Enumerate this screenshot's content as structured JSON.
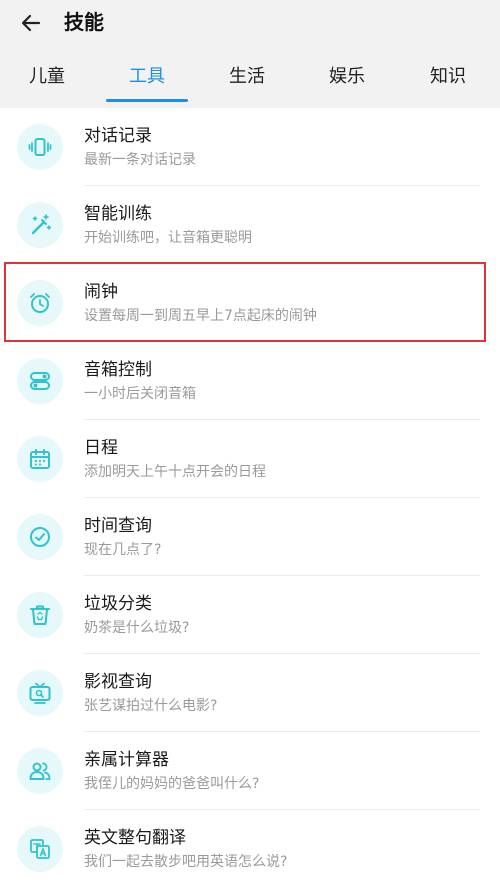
{
  "header": {
    "title": "技能",
    "tabs": [
      {
        "label": "儿童"
      },
      {
        "label": "工具"
      },
      {
        "label": "生活"
      },
      {
        "label": "娱乐"
      },
      {
        "label": "知识"
      }
    ],
    "active_tab": "工具"
  },
  "colors": {
    "accent": "#1f8fe6",
    "icon_bg": "#e6f8fa",
    "icon_fg": "#2fc3cc",
    "highlight": "#e0323a"
  },
  "skills": [
    {
      "name": "对话记录",
      "desc": "最新一条对话记录",
      "icon": "phone-vibrate-icon"
    },
    {
      "name": "智能训练",
      "desc": "开始训练吧，让音箱更聪明",
      "icon": "magic-wand-icon"
    },
    {
      "name": "闹钟",
      "desc": "设置每周一到周五早上7点起床的闹钟",
      "icon": "alarm-clock-icon"
    },
    {
      "name": "音箱控制",
      "desc": "一小时后关闭音箱",
      "icon": "toggle-control-icon"
    },
    {
      "name": "日程",
      "desc": "添加明天上午十点开会的日程",
      "icon": "calendar-icon"
    },
    {
      "name": "时间查询",
      "desc": "现在几点了?",
      "icon": "clock-check-icon"
    },
    {
      "name": "垃圾分类",
      "desc": "奶茶是什么垃圾?",
      "icon": "recycle-bin-icon"
    },
    {
      "name": "影视查询",
      "desc": "张艺谋拍过什么电影?",
      "icon": "tv-icon"
    },
    {
      "name": "亲属计算器",
      "desc": "我侄儿的妈妈的爸爸叫什么?",
      "icon": "people-icon"
    },
    {
      "name": "英文整句翻译",
      "desc": "我们一起去散步吧用英语怎么说?",
      "icon": "translate-icon"
    }
  ]
}
